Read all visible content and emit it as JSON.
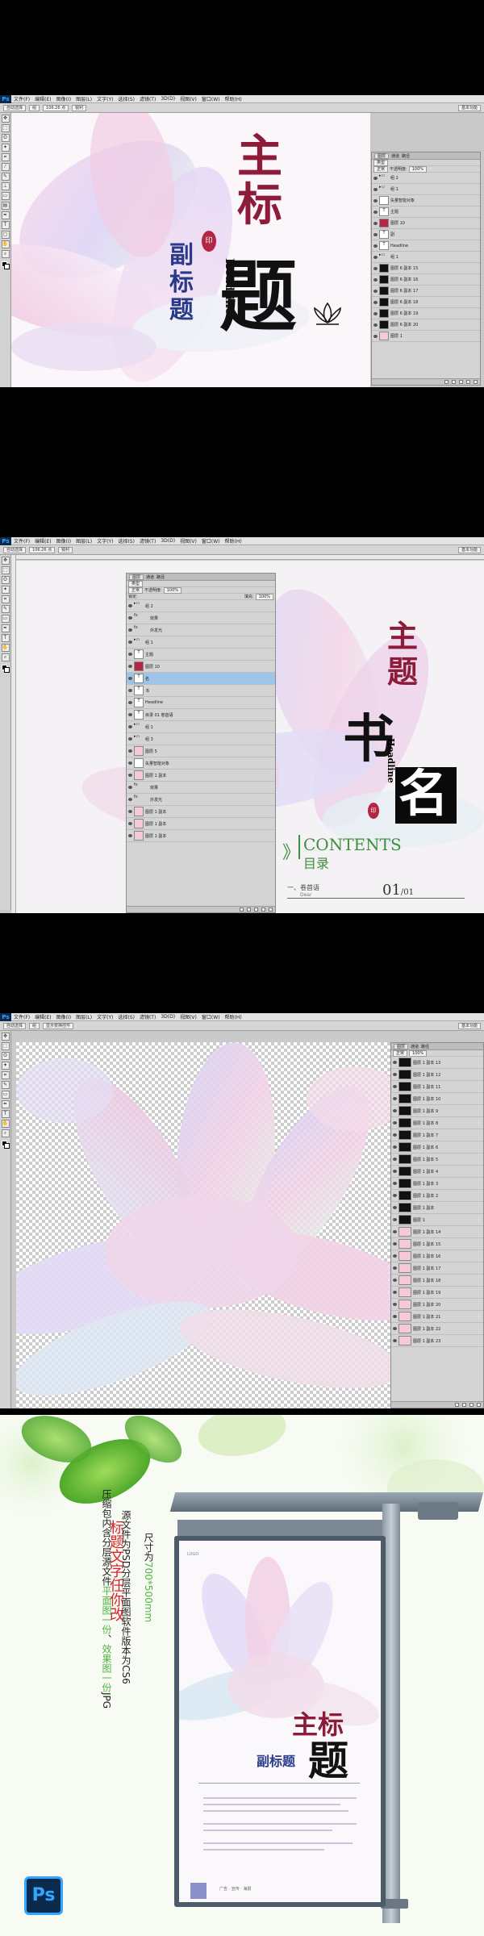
{
  "photoshop": {
    "logo": "Ps",
    "menus": [
      "文件(F)",
      "编辑(E)",
      "图像(I)",
      "图层(L)",
      "文字(Y)",
      "选择(S)",
      "滤镜(T)",
      "3D(D)",
      "视图(V)",
      "窗口(W)",
      "帮助(H)"
    ],
    "options_bar": {
      "tool_preset": "自动选择",
      "group_select": "组",
      "show_transform": "显示变换控件",
      "font_size": "106.26 点",
      "anti_alias": "锐利",
      "workspace": "基本功能"
    },
    "layers_panel": {
      "tabs": [
        "图层",
        "通道",
        "路径"
      ],
      "kind_filter": "类型",
      "blend_mode": "正常",
      "opacity_label": "不透明度:",
      "opacity_value": "100%",
      "lock_label": "锁定:",
      "fill_label": "填充:",
      "fill_value": "100%"
    }
  },
  "screen1": {
    "poster": {
      "title_chars": [
        "主",
        "标",
        "题"
      ],
      "subtitle_chars": [
        "副",
        "标",
        "题"
      ],
      "headline": "Headline",
      "seal_text": "印"
    },
    "layers": [
      {
        "name": "组 2",
        "type": "group"
      },
      {
        "name": "组 1",
        "type": "group"
      },
      {
        "name": "矢量智能对象",
        "type": "smart"
      },
      {
        "name": "主题",
        "type": "text"
      },
      {
        "name": "图层 10",
        "type": "red"
      },
      {
        "name": "副",
        "type": "text"
      },
      {
        "name": "Headline",
        "type": "text"
      },
      {
        "name": "组 1",
        "type": "group"
      },
      {
        "name": "图层 6 副本 15",
        "type": "dark"
      },
      {
        "name": "图层 6 副本 16",
        "type": "dark"
      },
      {
        "name": "图层 6 副本 17",
        "type": "dark"
      },
      {
        "name": "图层 6 副本 18",
        "type": "dark"
      },
      {
        "name": "图层 6 副本 19",
        "type": "dark"
      },
      {
        "name": "图层 6 副本 20",
        "type": "dark"
      },
      {
        "name": "图层 1",
        "type": "pink"
      }
    ]
  },
  "screen2": {
    "poster": {
      "title_chars": [
        "主",
        "题"
      ],
      "book_chars": [
        "书",
        "名"
      ],
      "headline": "Headline",
      "seal_text": "印",
      "contents_en": "CONTENTS",
      "contents_cn": "目录",
      "chevron": "》",
      "item_label": "一、卷首语",
      "item_sub": "Dear",
      "page_num": "01",
      "page_total": "/01"
    },
    "layers": [
      {
        "name": "组 2",
        "type": "group"
      },
      {
        "name": "效果",
        "type": "fx"
      },
      {
        "name": "外发光",
        "type": "fx"
      },
      {
        "name": "组 1",
        "type": "group"
      },
      {
        "name": "主题",
        "type": "text"
      },
      {
        "name": "图层 10",
        "type": "red"
      },
      {
        "name": "名",
        "type": "text",
        "selected": true
      },
      {
        "name": "书",
        "type": "text"
      },
      {
        "name": "Headline",
        "type": "text"
      },
      {
        "name": "目录 01 卷首语",
        "type": "text"
      },
      {
        "name": "组 1",
        "type": "group"
      },
      {
        "name": "组 3",
        "type": "group"
      },
      {
        "name": "图层 5",
        "type": "pink"
      },
      {
        "name": "矢量智能对象",
        "type": "smart"
      },
      {
        "name": "图层 1 副本",
        "type": "pink"
      },
      {
        "name": "效果",
        "type": "fx"
      },
      {
        "name": "外发光",
        "type": "fx"
      },
      {
        "name": "图层 1 副本",
        "type": "pink"
      },
      {
        "name": "图层 1 副本",
        "type": "pink"
      },
      {
        "name": "图层 1 副本",
        "type": "pink"
      }
    ]
  },
  "screen3": {
    "layers": [
      {
        "name": "图层 1 副本 13",
        "type": "dark"
      },
      {
        "name": "图层 1 副本 12",
        "type": "dark"
      },
      {
        "name": "图层 1 副本 11",
        "type": "dark"
      },
      {
        "name": "图层 1 副本 10",
        "type": "dark"
      },
      {
        "name": "图层 1 副本 9",
        "type": "dark"
      },
      {
        "name": "图层 1 副本 8",
        "type": "dark"
      },
      {
        "name": "图层 1 副本 7",
        "type": "dark"
      },
      {
        "name": "图层 1 副本 6",
        "type": "dark"
      },
      {
        "name": "图层 1 副本 5",
        "type": "dark"
      },
      {
        "name": "图层 1 副本 4",
        "type": "dark"
      },
      {
        "name": "图层 1 副本 3",
        "type": "dark"
      },
      {
        "name": "图层 1 副本 2",
        "type": "dark"
      },
      {
        "name": "图层 1 副本",
        "type": "dark"
      },
      {
        "name": "图层 1",
        "type": "dark"
      },
      {
        "name": "图层 1 副本 14",
        "type": "pink"
      },
      {
        "name": "图层 1 副本 15",
        "type": "pink"
      },
      {
        "name": "图层 1 副本 16",
        "type": "pink"
      },
      {
        "name": "图层 1 副本 17",
        "type": "pink"
      },
      {
        "name": "图层 1 副本 18",
        "type": "pink"
      },
      {
        "name": "图层 1 副本 19",
        "type": "pink"
      },
      {
        "name": "图层 1 副本 20",
        "type": "pink"
      },
      {
        "name": "图层 1 副本 21",
        "type": "pink"
      },
      {
        "name": "图层 1 副本 22",
        "type": "pink"
      },
      {
        "name": "图层 1 副本 23",
        "type": "pink"
      }
    ]
  },
  "promo": {
    "line1": "压缩包内含分层源文件平面图一份、效果图一份JPG",
    "line2": "源文件为PSD分层平面图软件版本为CS6",
    "line3": "尺寸为700*500mm",
    "line4": "标题文字任你改",
    "poster_title_chars": [
      "主",
      "标",
      "题"
    ],
    "poster_subtitle": "副标题",
    "poster_corner": "LOGO",
    "poster_footer": "广告 · 宣传 · 海报",
    "ps_badge": "Ps",
    "colors": {
      "highlight": "#4fb640",
      "line4": "#d9252a",
      "line1": "#222222"
    }
  }
}
